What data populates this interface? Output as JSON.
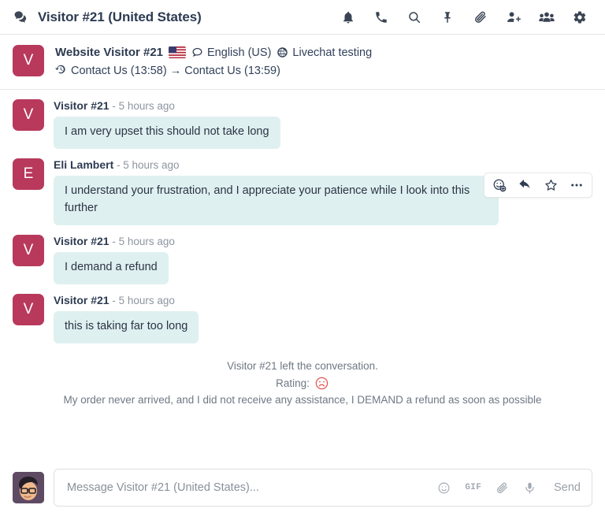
{
  "header": {
    "chat_icon": "chat-bubbles-icon",
    "title": "Visitor #21 (United States)",
    "actions": [
      {
        "name": "notifications-icon",
        "label": "Notifications"
      },
      {
        "name": "phone-icon",
        "label": "Call"
      },
      {
        "name": "search-icon",
        "label": "Search"
      },
      {
        "name": "pin-icon",
        "label": "Pinned"
      },
      {
        "name": "attachment-icon",
        "label": "Attachments"
      },
      {
        "name": "add-user-icon",
        "label": "Add user"
      },
      {
        "name": "members-icon",
        "label": "Members"
      },
      {
        "name": "settings-gear-icon",
        "label": "Settings"
      }
    ]
  },
  "visitor": {
    "avatar_letter": "V",
    "avatar_color": "#b8395c",
    "name": "Website Visitor #21",
    "country_flag": "united-states-flag",
    "language": "English (US)",
    "website": "Livechat testing",
    "history": "Contact Us (13:58) → Contact Us (13:59)"
  },
  "messages": [
    {
      "author": "Visitor #21",
      "time": "- 5 hours ago",
      "avatar_letter": "V",
      "text": "I am very upset this should not take long",
      "has_hover_actions": false
    },
    {
      "author": "Eli Lambert",
      "time": "- 5 hours ago",
      "avatar_letter": "E",
      "text": "I understand your frustration, and I appreciate your patience while I look into this further",
      "has_hover_actions": true
    },
    {
      "author": "Visitor #21",
      "time": "- 5 hours ago",
      "avatar_letter": "V",
      "text": "I demand a refund",
      "has_hover_actions": false
    },
    {
      "author": "Visitor #21",
      "time": "- 5 hours ago",
      "avatar_letter": "V",
      "text": "this is taking far too long",
      "has_hover_actions": false
    }
  ],
  "hover_actions": [
    {
      "name": "add-reaction-icon",
      "label": "Add a Reaction"
    },
    {
      "name": "reply-icon",
      "label": "Reply"
    },
    {
      "name": "star-icon",
      "label": "Mark as Todo"
    },
    {
      "name": "more-actions-icon",
      "label": "Expand"
    }
  ],
  "system": {
    "left_conversation": "Visitor #21 left the conversation.",
    "rating_label": "Rating:",
    "rating_emoji": "sad-face-icon",
    "rating_color": "#e4564f",
    "feedback": "My order never arrived, and I did not receive any assistance, I DEMAND a refund as soon as possible"
  },
  "composer": {
    "avatar": "user-avatar",
    "placeholder": "Message Visitor #21 (United States)...",
    "value": "",
    "icons": [
      {
        "name": "emoji-icon",
        "label": "Emoji"
      },
      {
        "name": "gif-icon",
        "label": "GIF"
      },
      {
        "name": "attachment-icon",
        "label": "Attach files"
      },
      {
        "name": "voice-message-icon",
        "label": "Voice message"
      }
    ],
    "send_label": "Send"
  },
  "colors": {
    "bubble": "#dff0f0",
    "accent": "#b8395c",
    "text": "#2d3b52",
    "muted": "#8d95a0"
  }
}
